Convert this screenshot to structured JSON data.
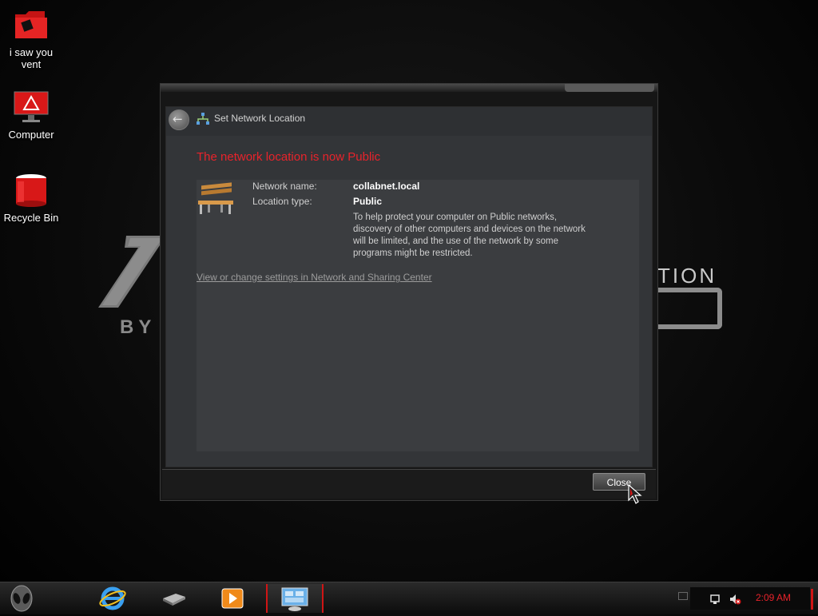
{
  "desktop": {
    "icons": [
      {
        "label": "i saw you vent"
      },
      {
        "label": "Computer"
      },
      {
        "label": "Recycle Bin"
      }
    ],
    "wallpaper": {
      "text_by": "BY",
      "text_tion": "TION"
    }
  },
  "dialog": {
    "title": "Set Network Location",
    "headline": "The network location is now Public",
    "network_name_label": "Network name:",
    "network_name_value": "collabnet.local",
    "location_type_label": "Location type:",
    "location_type_value": "Public",
    "description": "To help protect your computer on Public networks, discovery of other computers and devices on the network will be limited, and the use of the network by some programs might be restricted.",
    "settings_link": "View or change settings in Network and Sharing Center",
    "close_label": "Close",
    "accent_color": "#e8232b"
  },
  "taskbar": {
    "pinned": [
      {
        "icon": "internet-explorer-icon"
      },
      {
        "icon": "network-device-icon"
      },
      {
        "icon": "media-player-icon"
      },
      {
        "icon": "control-panel-icon",
        "active": true
      }
    ],
    "clock": "2:09 AM",
    "tray_icons": [
      "network-icon",
      "volume-muted-icon"
    ]
  }
}
